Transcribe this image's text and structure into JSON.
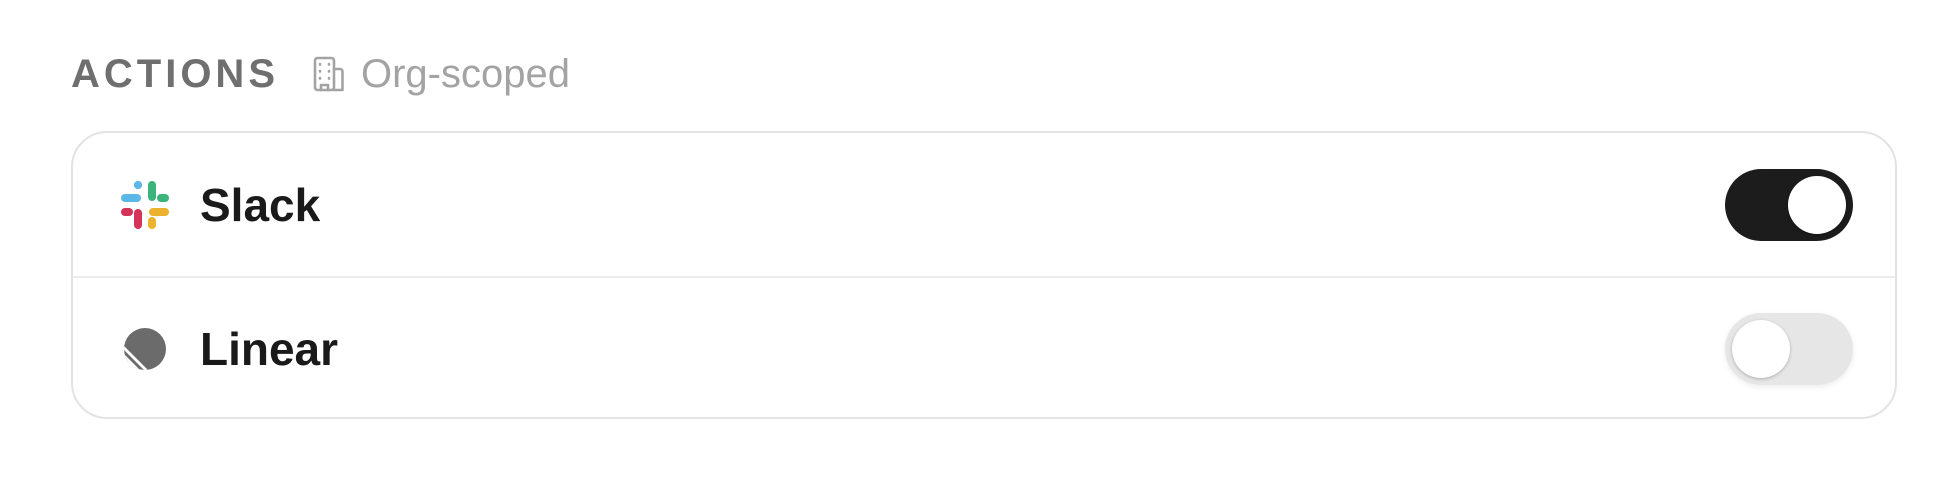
{
  "section": {
    "title": "ACTIONS",
    "scope_icon": "building-icon",
    "scope_label": "Org-scoped"
  },
  "integrations": [
    {
      "name": "Slack",
      "icon": "slack-icon",
      "enabled": true
    },
    {
      "name": "Linear",
      "icon": "linear-icon",
      "enabled": false
    }
  ],
  "colors": {
    "toggle_on": "#1c1c1c",
    "toggle_off": "#e6e6e6",
    "title": "#6f6f6f",
    "muted": "#a3a3a3"
  }
}
